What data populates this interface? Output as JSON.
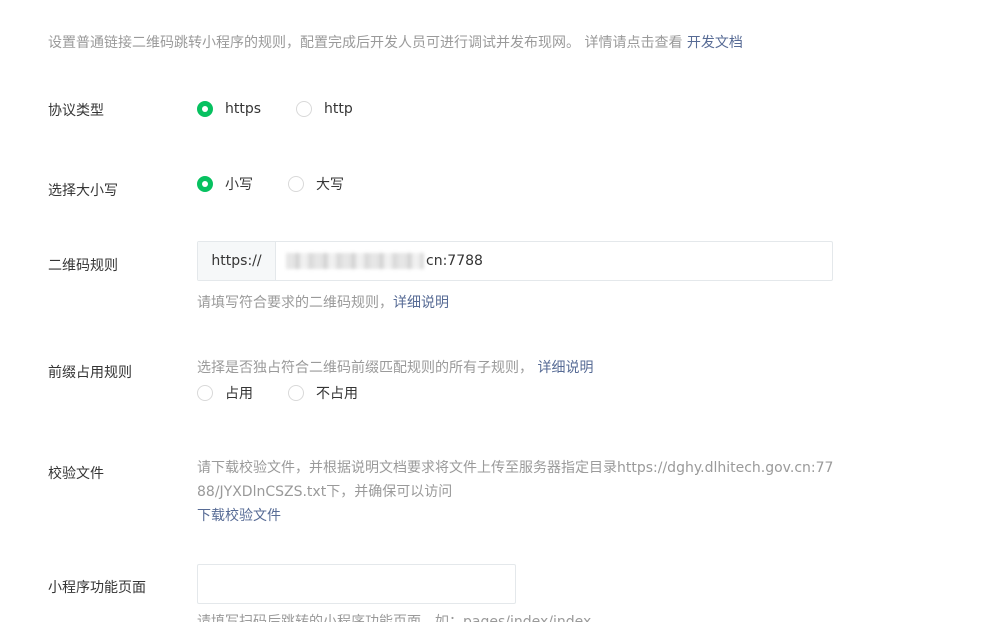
{
  "intro": {
    "text": "设置普通链接二维码跳转小程序的规则，配置完成后开发人员可进行调试并发布现网。 详情请点击查看 ",
    "link": "开发文档"
  },
  "protocol": {
    "label": "协议类型",
    "options": [
      {
        "label": "https",
        "checked": true
      },
      {
        "label": "http",
        "checked": false
      }
    ]
  },
  "case": {
    "label": "选择大小写",
    "options": [
      {
        "label": "小写",
        "checked": true
      },
      {
        "label": "大写",
        "checked": false
      }
    ]
  },
  "qr_rule": {
    "label": "二维码规则",
    "prefix": "https://",
    "value_visible": "cn:7788",
    "hint": "请填写符合要求的二维码规则，",
    "hint_link": "详细说明"
  },
  "prefix_rule": {
    "label": "前缀占用规则",
    "hint": "选择是否独占符合二维码前缀匹配规则的所有子规则，",
    "hint_link": "详细说明",
    "options": [
      {
        "label": "占用",
        "checked": false
      },
      {
        "label": "不占用",
        "checked": false
      }
    ]
  },
  "verify_file": {
    "label": "校验文件",
    "text": "请下载校验文件，并根据说明文档要求将文件上传至服务器指定目录https://dghy.dlhitech.gov.cn:7788/JYXDlnCSZS.txt下，并确保可以访问",
    "link": "下载校验文件"
  },
  "mini_page": {
    "label": "小程序功能页面",
    "hint": "请填写扫码后跳转的小程序功能页面，如：pages/index/index"
  },
  "colors": {
    "accent": "#07c160",
    "link": "#576b95",
    "muted": "#9a9a9a"
  }
}
